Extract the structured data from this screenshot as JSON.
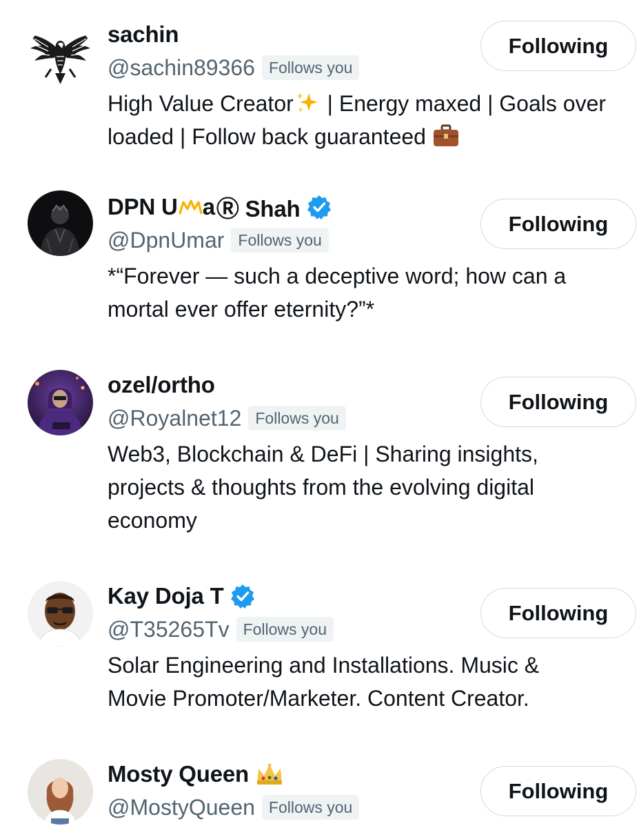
{
  "follows_badge": "Follows you",
  "colors": {
    "text_primary": "#0f1419",
    "text_secondary": "#536471",
    "badge_bg": "#eff3f4",
    "button_border": "#cfd9de",
    "verified_blue": "#1d9bf0"
  },
  "users": [
    {
      "display_name": "sachin",
      "handle": "@sachin89366",
      "follows_you": "Follows you",
      "button_label": "Following",
      "verified": false,
      "bio_part1": "High Value Creator",
      "bio_emoji1": "sparkles-emoji",
      "bio_part2": " | Energy maxed | Goals over loaded | Follow back guaranteed ",
      "bio_emoji2": "briefcase-emoji",
      "avatar_icon": "eagle-icon"
    },
    {
      "display_name_a": "DPN U",
      "display_name_b": "a",
      "display_name_c": "Ⓡ Shah",
      "handle": "@DpnUmar",
      "follows_you": "Follows you",
      "button_label": "Following",
      "verified": true,
      "bio": "*“Forever — such a deceptive word; how can a mortal ever offer eternity?”*",
      "avatar_icon": "dark-portrait-avatar"
    },
    {
      "display_name": "ozel/ortho",
      "handle": "@Royalnet12",
      "follows_you": "Follows you",
      "button_label": "Following",
      "verified": false,
      "bio": "Web3, Blockchain & DeFi | Sharing insights, projects & thoughts from the evolving digital economy",
      "avatar_icon": "purple-hoodie-avatar"
    },
    {
      "display_name": "Kay Doja T",
      "handle": "@T35265Tv",
      "follows_you": "Follows you",
      "button_label": "Following",
      "verified": true,
      "bio": "Solar Engineering and Installations. Music & Movie Promoter/Marketer. Content Creator.",
      "avatar_icon": "man-with-glasses-avatar"
    },
    {
      "display_name": "Mosty Queen",
      "handle": "@MostyQueen",
      "follows_you": "Follows you",
      "button_label": "Following",
      "verified": false,
      "name_emoji": "crown-emoji",
      "avatar_icon": "woman-portrait-avatar"
    }
  ]
}
